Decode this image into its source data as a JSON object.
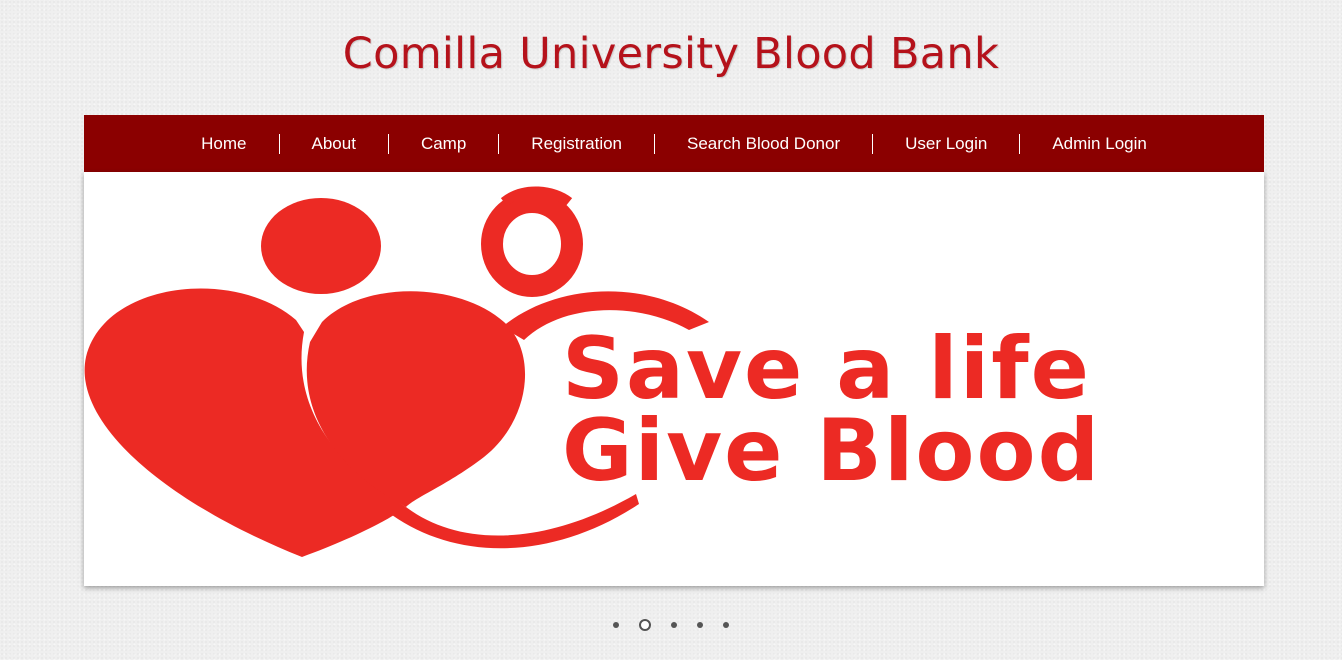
{
  "site": {
    "title": "Comilla University Blood Bank"
  },
  "nav": {
    "items": [
      {
        "label": "Home"
      },
      {
        "label": "About"
      },
      {
        "label": "Camp"
      },
      {
        "label": "Registration"
      },
      {
        "label": "Search Blood Donor"
      },
      {
        "label": "User Login"
      },
      {
        "label": "Admin Login"
      }
    ]
  },
  "banner": {
    "line1": "Save a life",
    "line2": "Give Blood",
    "logo_icon": "blood-donation-hearts-icon"
  },
  "slider": {
    "slide_count": 5,
    "active_index": 1
  },
  "colors": {
    "title": "#b5121b",
    "nav_background": "#8b0000",
    "banner_red": "#ec2a24",
    "dot": "#555555"
  }
}
